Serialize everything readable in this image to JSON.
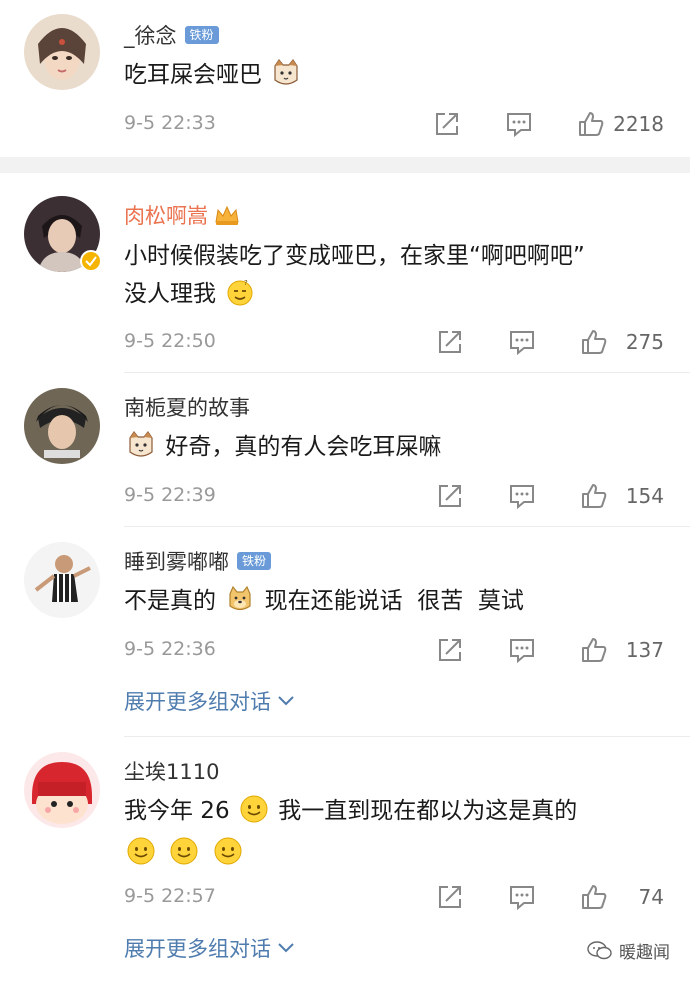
{
  "comments": [
    {
      "username": "_徐念",
      "badge": "铁粉",
      "text": "吃耳屎会哑巴",
      "time": "9-5 22:33",
      "likes": "2218"
    },
    {
      "username": "肉松啊嵩",
      "text_line1": "小时候假装吃了变成哑巴，在家里“啊吧啊吧”",
      "text_line2": "没人理我",
      "time": "9-5 22:50",
      "likes": "275"
    },
    {
      "username": "南栀夏的故事",
      "text": "好奇，真的有人会吃耳屎嘛",
      "time": "9-5 22:39",
      "likes": "154"
    },
    {
      "username": "睡到雾嘟嘟",
      "badge": "铁粉",
      "text_a": "不是真的",
      "text_b": "现在还能说话  很苦  莫试",
      "time": "9-5 22:36",
      "likes": "137"
    },
    {
      "username": "尘埃1110",
      "text_a": "我今年 26",
      "text_b": "我一直到现在都以为这是真的",
      "time": "9-5 22:57",
      "likes": "74"
    }
  ],
  "expand_label": "展开更多组对话",
  "watermark": "暖趣闻",
  "colors": {
    "accent_link": "#4f7cae",
    "username_vip": "#eb7350",
    "badge": "#6a9bd8"
  }
}
